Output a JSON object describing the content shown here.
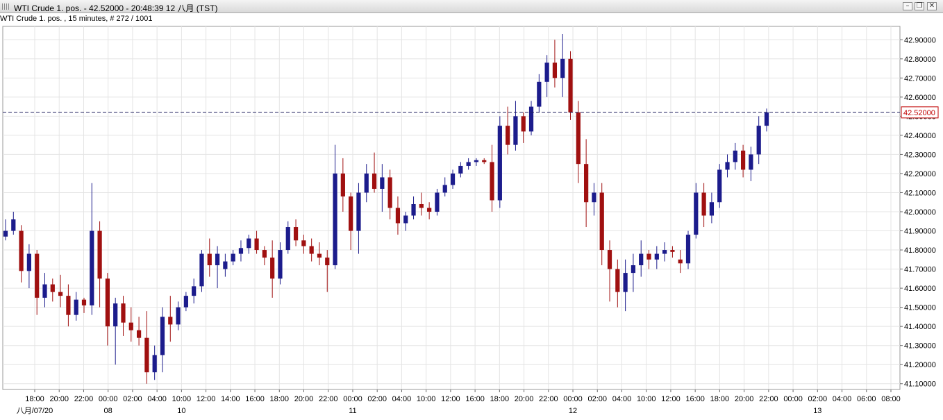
{
  "window": {
    "title": "WTI Crude 1. pos. - 42.52000 - 20:48:39  12 八月 (TST)",
    "buttons": [
      "–",
      "❐",
      "✕"
    ]
  },
  "subtitle": "WTI Crude 1. pos. , 15 minutes, # 272 / 1001",
  "colors": {
    "up": "#1c1c8c",
    "down": "#a01010",
    "grid": "#e4e4e4",
    "last_price_box": "#c00000"
  },
  "chart_data": {
    "type": "candlestick",
    "interval": "15 minutes",
    "ylim": [
      41.07,
      42.97
    ],
    "y_ticks": [
      "41.10000",
      "41.20000",
      "41.30000",
      "41.40000",
      "41.50000",
      "41.60000",
      "41.70000",
      "41.80000",
      "41.90000",
      "42.00000",
      "42.10000",
      "42.20000",
      "42.30000",
      "42.40000",
      "42.50000",
      "42.60000",
      "42.70000",
      "42.80000",
      "42.90000"
    ],
    "last_price": 42.52,
    "last_price_label": "42.52000",
    "x_ticks": [
      "18:00",
      "20:00",
      "22:00",
      "00:00",
      "02:00",
      "04:00",
      "10:00",
      "12:00",
      "14:00",
      "16:00",
      "18:00",
      "20:00",
      "22:00",
      "00:00",
      "02:00",
      "04:00",
      "10:00",
      "12:00",
      "16:00",
      "18:00",
      "20:00",
      "22:00",
      "00:00",
      "02:00",
      "04:00",
      "10:00",
      "12:00",
      "16:00",
      "18:00",
      "20:00",
      "22:00",
      "00:00",
      "02:00",
      "04:00",
      "06:00",
      "08:00"
    ],
    "date_labels": [
      "八月/07/20",
      "08",
      "10",
      "11",
      "12",
      "13"
    ],
    "candles": [
      [
        41.87,
        41.96,
        41.85,
        41.9
      ],
      [
        41.9,
        42.0,
        41.88,
        41.96
      ],
      [
        41.9,
        41.93,
        41.63,
        41.69
      ],
      [
        41.69,
        41.83,
        41.6,
        41.78
      ],
      [
        41.78,
        41.8,
        41.46,
        41.55
      ],
      [
        41.55,
        41.68,
        41.5,
        41.62
      ],
      [
        41.62,
        41.65,
        41.53,
        41.58
      ],
      [
        41.58,
        41.67,
        41.5,
        41.56
      ],
      [
        41.56,
        41.62,
        41.4,
        41.46
      ],
      [
        41.46,
        41.58,
        41.43,
        41.54
      ],
      [
        41.54,
        41.55,
        41.47,
        41.51
      ],
      [
        41.51,
        42.15,
        41.46,
        41.9
      ],
      [
        41.9,
        41.95,
        41.5,
        41.65
      ],
      [
        41.65,
        41.68,
        41.3,
        41.4
      ],
      [
        41.4,
        41.55,
        41.2,
        41.52
      ],
      [
        41.52,
        41.56,
        41.35,
        41.42
      ],
      [
        41.42,
        41.5,
        41.32,
        41.38
      ],
      [
        41.38,
        41.45,
        41.3,
        41.34
      ],
      [
        41.34,
        41.48,
        41.1,
        41.16
      ],
      [
        41.16,
        41.3,
        41.12,
        41.25
      ],
      [
        41.25,
        41.5,
        41.16,
        41.45
      ],
      [
        41.45,
        41.56,
        41.32,
        41.41
      ],
      [
        41.41,
        41.53,
        41.38,
        41.5
      ],
      [
        41.5,
        41.58,
        41.48,
        41.56
      ],
      [
        41.56,
        41.65,
        41.52,
        41.61
      ],
      [
        41.61,
        41.8,
        41.58,
        41.78
      ],
      [
        41.78,
        41.86,
        41.66,
        41.72
      ],
      [
        41.72,
        41.82,
        41.6,
        41.78
      ],
      [
        41.7,
        41.78,
        41.66,
        41.74
      ],
      [
        41.74,
        41.8,
        41.72,
        41.78
      ],
      [
        41.78,
        41.85,
        41.74,
        41.81
      ],
      [
        41.81,
        41.88,
        41.78,
        41.86
      ],
      [
        41.86,
        41.9,
        41.78,
        41.8
      ],
      [
        41.8,
        41.82,
        41.72,
        41.76
      ],
      [
        41.76,
        41.85,
        41.55,
        41.65
      ],
      [
        41.65,
        41.84,
        41.62,
        41.8
      ],
      [
        41.8,
        41.95,
        41.78,
        41.92
      ],
      [
        41.92,
        41.96,
        41.82,
        41.85
      ],
      [
        41.85,
        41.88,
        41.78,
        41.82
      ],
      [
        41.82,
        41.86,
        41.74,
        41.78
      ],
      [
        41.78,
        41.84,
        41.72,
        41.76
      ],
      [
        41.76,
        41.8,
        41.58,
        41.72
      ],
      [
        41.72,
        42.35,
        41.7,
        42.2
      ],
      [
        42.2,
        42.28,
        42.0,
        42.08
      ],
      [
        42.08,
        42.1,
        41.8,
        41.9
      ],
      [
        41.9,
        42.15,
        41.78,
        42.1
      ],
      [
        42.1,
        42.25,
        42.05,
        42.2
      ],
      [
        42.2,
        42.31,
        42.1,
        42.12
      ],
      [
        42.12,
        42.25,
        42.0,
        42.18
      ],
      [
        42.18,
        42.22,
        41.96,
        42.02
      ],
      [
        42.02,
        42.08,
        41.88,
        41.94
      ],
      [
        41.94,
        42.0,
        41.9,
        41.98
      ],
      [
        41.98,
        42.08,
        41.96,
        42.04
      ],
      [
        42.04,
        42.1,
        41.98,
        42.02
      ],
      [
        42.02,
        42.05,
        41.96,
        42.0
      ],
      [
        42.0,
        42.12,
        41.98,
        42.1
      ],
      [
        42.1,
        42.18,
        42.08,
        42.14
      ],
      [
        42.14,
        42.22,
        42.12,
        42.2
      ],
      [
        42.2,
        42.26,
        42.18,
        42.24
      ],
      [
        42.24,
        42.28,
        42.22,
        42.26
      ],
      [
        42.26,
        42.28,
        42.24,
        42.27
      ],
      [
        42.27,
        42.28,
        42.25,
        42.26
      ],
      [
        42.26,
        42.35,
        42.0,
        42.06
      ],
      [
        42.06,
        42.5,
        42.02,
        42.45
      ],
      [
        42.45,
        42.55,
        42.3,
        42.35
      ],
      [
        42.35,
        42.58,
        42.32,
        42.5
      ],
      [
        42.5,
        42.52,
        42.36,
        42.42
      ],
      [
        42.42,
        42.58,
        42.4,
        42.55
      ],
      [
        42.55,
        42.72,
        42.52,
        42.68
      ],
      [
        42.68,
        42.82,
        42.6,
        42.78
      ],
      [
        42.78,
        42.9,
        42.65,
        42.7
      ],
      [
        42.7,
        42.93,
        42.6,
        42.8
      ],
      [
        42.8,
        42.84,
        42.48,
        42.52
      ],
      [
        42.52,
        42.58,
        42.15,
        42.25
      ],
      [
        42.25,
        42.38,
        41.92,
        42.05
      ],
      [
        42.05,
        42.15,
        41.98,
        42.1
      ],
      [
        42.1,
        42.15,
        41.72,
        41.8
      ],
      [
        41.8,
        41.85,
        41.53,
        41.7
      ],
      [
        41.7,
        41.75,
        41.5,
        41.58
      ],
      [
        41.58,
        41.75,
        41.48,
        41.68
      ],
      [
        41.68,
        41.78,
        41.58,
        41.72
      ],
      [
        41.72,
        41.85,
        41.66,
        41.78
      ],
      [
        41.78,
        41.8,
        41.7,
        41.75
      ],
      [
        41.75,
        41.82,
        41.7,
        41.78
      ],
      [
        41.78,
        41.84,
        41.74,
        41.8
      ],
      [
        41.8,
        41.82,
        41.76,
        41.79
      ],
      [
        41.75,
        41.8,
        41.68,
        41.73
      ],
      [
        41.73,
        41.9,
        41.7,
        41.88
      ],
      [
        41.88,
        42.15,
        41.86,
        42.1
      ],
      [
        42.1,
        42.15,
        41.92,
        41.98
      ],
      [
        41.98,
        42.1,
        41.94,
        42.05
      ],
      [
        42.05,
        42.25,
        42.02,
        42.22
      ],
      [
        42.22,
        42.3,
        42.18,
        42.26
      ],
      [
        42.26,
        42.36,
        42.22,
        42.32
      ],
      [
        42.32,
        42.35,
        42.18,
        42.22
      ],
      [
        42.22,
        42.34,
        42.16,
        42.3
      ],
      [
        42.3,
        42.5,
        42.25,
        42.45
      ],
      [
        42.45,
        42.54,
        42.42,
        42.52
      ]
    ]
  }
}
